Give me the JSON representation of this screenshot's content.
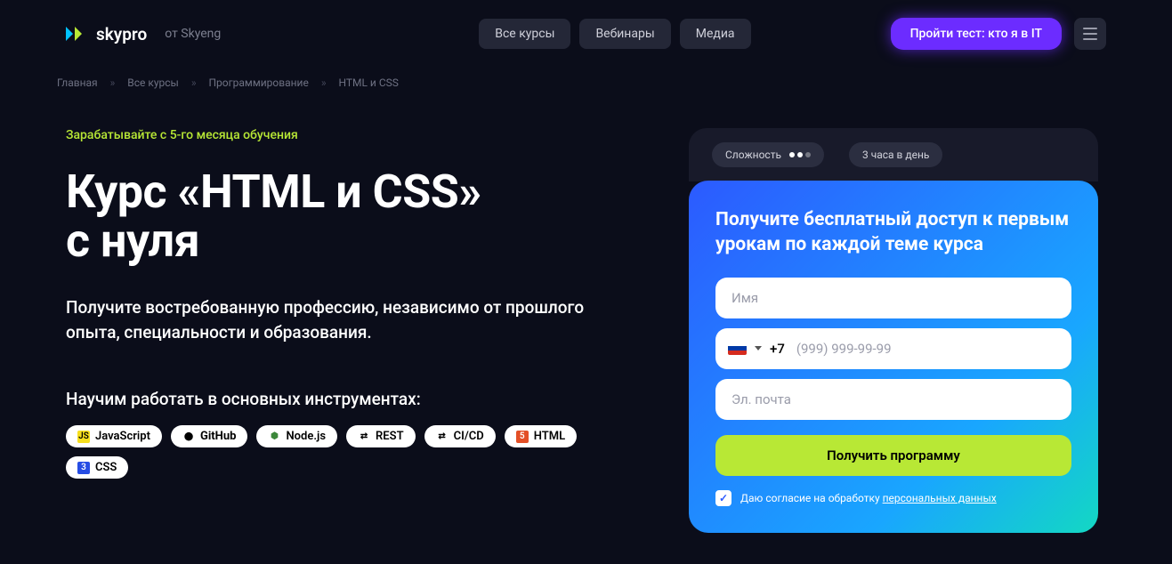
{
  "header": {
    "logo_text": "skypro",
    "from_skyeng": "от Skyeng",
    "nav": [
      "Все курсы",
      "Вебинары",
      "Медиа"
    ],
    "cta": "Пройти тест: кто я в IT"
  },
  "breadcrumb": [
    "Главная",
    "Все курсы",
    "Программирование",
    "HTML и CSS"
  ],
  "hero": {
    "tagline": "Зарабатывайте с 5-го месяца обучения",
    "title_line1": "Курс «HTML и CSS»",
    "title_line2": "с нуля",
    "subtitle": "Получите востребованную профессию, независимо от прошлого опыта, специальности и образования.",
    "tools_heading": "Научим работать в основных инструментах:",
    "tools": [
      {
        "name": "JavaScript",
        "icon": "js",
        "color": "#f7df1e"
      },
      {
        "name": "GitHub",
        "icon": "gh",
        "color": "#000"
      },
      {
        "name": "Node.js",
        "icon": "node",
        "color": "#3c873a"
      },
      {
        "name": "REST",
        "icon": "rest",
        "color": "#000"
      },
      {
        "name": "CI/CD",
        "icon": "cicd",
        "color": "#000"
      },
      {
        "name": "HTML",
        "icon": "html",
        "color": "#e34f26"
      },
      {
        "name": "CSS",
        "icon": "css",
        "color": "#264de4"
      }
    ]
  },
  "info": {
    "difficulty_label": "Сложность",
    "hours_label": "3 часа в день"
  },
  "form": {
    "title": "Получите бесплатный доступ к первым урокам по каждой теме курса",
    "name_placeholder": "Имя",
    "phone_prefix": "+7",
    "phone_placeholder": "(999) 999-99-99",
    "email_placeholder": "Эл. почта",
    "submit": "Получить программу",
    "consent_text": "Даю согласие на обработку ",
    "consent_link": "персональных данных"
  }
}
